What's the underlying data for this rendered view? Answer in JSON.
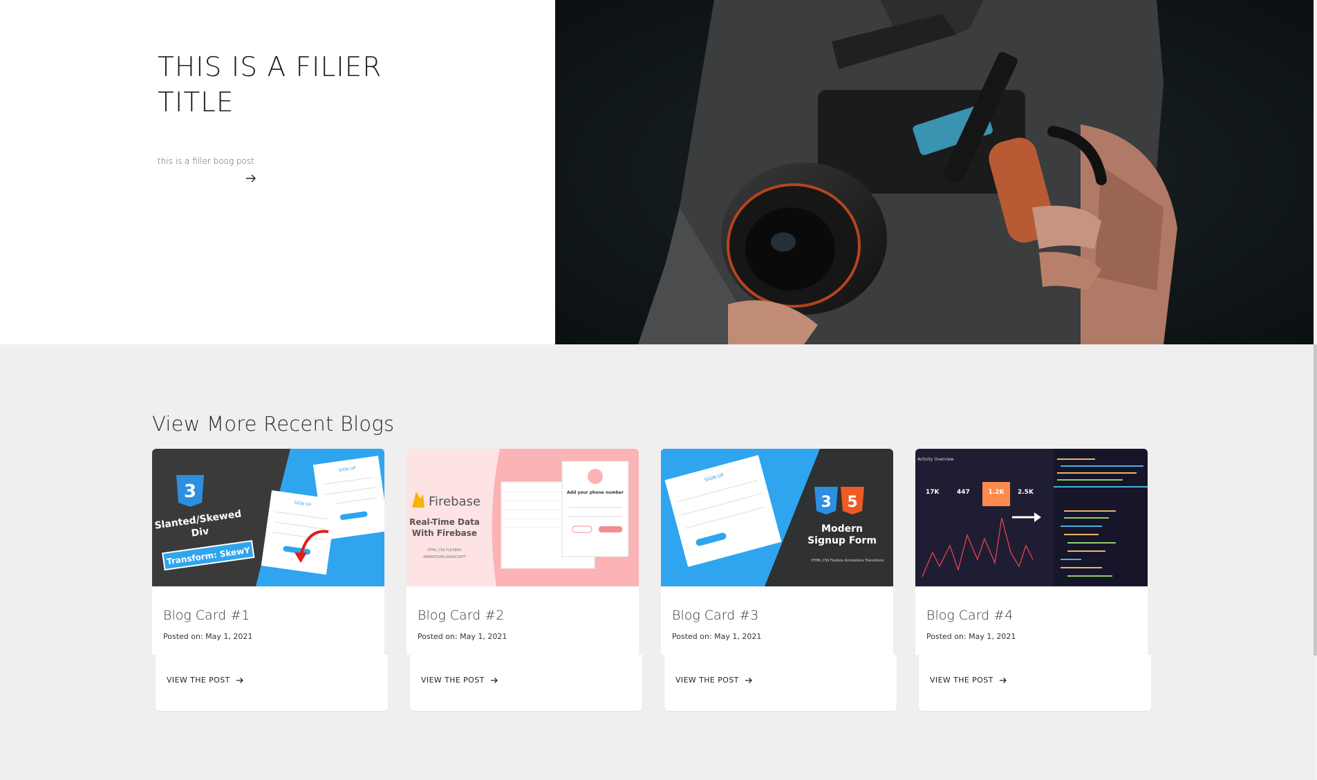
{
  "hero": {
    "title": "THIS IS A FILIER TITLE",
    "subtitle": "this is a filler boog post",
    "arrow_icon": "arrow-right-icon",
    "image": "photo of a person holding a cinema camera rig"
  },
  "section": {
    "title": "View More Recent Blogs"
  },
  "cards": [
    {
      "title": "Blog Card #1",
      "date": "Posted on: May 1, 2021",
      "link": "VIEW THE POST",
      "thumb": {
        "line1": "Slanted/Skewed",
        "line2": "Div",
        "badge": "Transform: SkewY",
        "form_title": "SIGN UP"
      }
    },
    {
      "title": "Blog Card #2",
      "date": "Posted on: May 1, 2021",
      "link": "VIEW THE POST",
      "thumb": {
        "brand": "Firebase",
        "line1": "Real-Time Data",
        "line2": "With Firebase",
        "tags1": "HTML   CSS   FLEXBOX",
        "tags2": "ANIMATIONS   JAVASCRIPT",
        "phone_title": "Add your phone number"
      }
    },
    {
      "title": "Blog Card #3",
      "date": "Posted on: May 1, 2021",
      "link": "VIEW THE POST",
      "thumb": {
        "form_title": "SIGN UP",
        "line1": "Modern",
        "line2": "Signup Form",
        "tags": "HTML   CSS   Flexbox   Animations   Transitions"
      }
    },
    {
      "title": "Blog Card #4",
      "date": "Posted on: May 1, 2021",
      "link": "VIEW THE POST",
      "thumb": {
        "panel_title": "Activity Overview",
        "stat1": "17K",
        "stat2": "447",
        "stat3": "1.2K",
        "stat4": "2.5K"
      }
    }
  ],
  "colors": {
    "background": "#efefef",
    "accent_blue": "#2aa3ef",
    "accent_orange": "#ff8a4c",
    "firebase_pink": "#fbb3b6"
  }
}
